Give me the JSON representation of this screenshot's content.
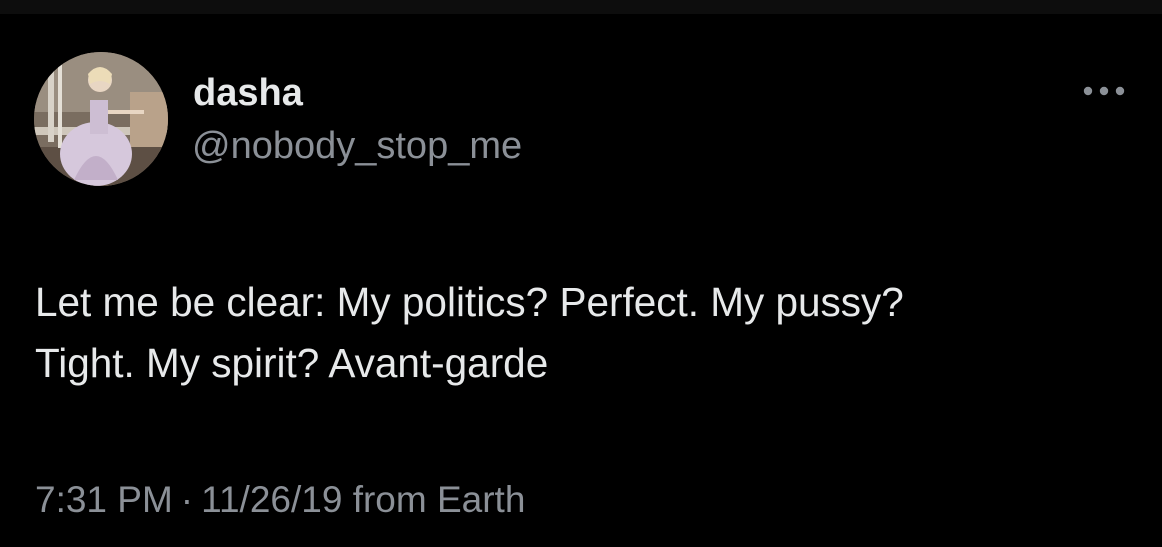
{
  "tweet": {
    "author": {
      "display_name": "dasha",
      "handle": "@nobody_stop_me",
      "avatar_icon": "profile-photo"
    },
    "more_icon": "more-horizontal-icon",
    "text_line1": "Let me be clear: My politics? Perfect. My pussy?",
    "text_line2": "Tight. My spirit? Avant-garde",
    "time": "7:31 PM",
    "separator": "·",
    "date": "11/26/19",
    "source": "from Earth"
  },
  "colors": {
    "background": "#000000",
    "primary_text": "#e7e9ea",
    "secondary_text": "#8b9097"
  }
}
